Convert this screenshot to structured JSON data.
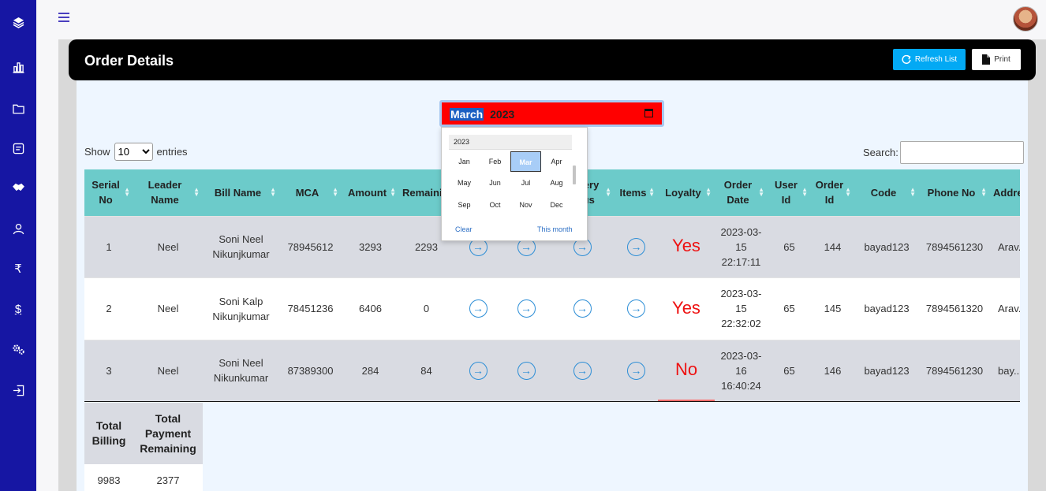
{
  "sidebar": {
    "items": [
      {
        "icon": "layers-icon"
      },
      {
        "icon": "bar-chart-icon"
      },
      {
        "icon": "folder-icon"
      },
      {
        "icon": "document-icon"
      },
      {
        "icon": "handshake-icon"
      },
      {
        "icon": "user-icon"
      },
      {
        "icon": "rupee-icon",
        "glyph": "₹"
      },
      {
        "icon": "dollar-icon",
        "glyph": "$"
      },
      {
        "icon": "gears-icon"
      },
      {
        "icon": "logout-icon"
      }
    ],
    "background": "#1616a3"
  },
  "header": {
    "title": "Order Details",
    "refresh_label": "Refresh List",
    "print_label": "Print"
  },
  "month_input": {
    "month": "March",
    "year": "2023",
    "background": "#ff0000"
  },
  "picker": {
    "year": "2023",
    "months": [
      "Jan",
      "Feb",
      "Mar",
      "Apr",
      "May",
      "Jun",
      "Jul",
      "Aug",
      "Sep",
      "Oct",
      "Nov",
      "Dec"
    ],
    "selected": "Mar",
    "clear_label": "Clear",
    "this_month_label": "This month"
  },
  "controls": {
    "show_label": "Show",
    "entries_value": "10",
    "entries_label": "entries",
    "search_label": "Search:"
  },
  "table": {
    "headers": [
      "Serial No",
      "Leader Name",
      "Bill Name",
      "MCA",
      "Amount",
      "Remaining",
      "",
      "",
      "Delivery Status",
      "Items",
      "Loyalty",
      "Order Date",
      "User Id",
      "Order Id",
      "Code",
      "Phone No",
      "Address"
    ],
    "rows": [
      {
        "serial": "1",
        "leader": "Neel",
        "bill_name": "Soni Neel Nikunjkumar",
        "mca": "78945612",
        "amount": "3293",
        "remaining": "2293",
        "loyalty": "Yes",
        "order_date": "2023-03-15 22:17:11",
        "user_id": "65",
        "order_id": "144",
        "code": "bayad123",
        "phone": "7894561230",
        "address": "Arav..."
      },
      {
        "serial": "2",
        "leader": "Neel",
        "bill_name": "Soni Kalp Nikunjkumar",
        "mca": "78451236",
        "amount": "6406",
        "remaining": "0",
        "loyalty": "Yes",
        "order_date": "2023-03-15 22:32:02",
        "user_id": "65",
        "order_id": "145",
        "code": "bayad123",
        "phone": "7894561320",
        "address": "Arav..."
      },
      {
        "serial": "3",
        "leader": "Neel",
        "bill_name": "Soni Neel Nikunkumar",
        "mca": "87389300",
        "amount": "284",
        "remaining": "84",
        "loyalty": "No",
        "order_date": "2023-03-16 16:40:24",
        "user_id": "65",
        "order_id": "146",
        "code": "bayad123",
        "phone": "7894561230",
        "address": "bay..."
      }
    ]
  },
  "totals": {
    "headers": [
      "Total Billing",
      "Total Payment Remaining"
    ],
    "values": [
      "9983",
      "2377"
    ]
  },
  "colors": {
    "table_header": "#6ccbca",
    "loyalty_text": "#ee1111",
    "refresh_button": "#03a9f4"
  }
}
